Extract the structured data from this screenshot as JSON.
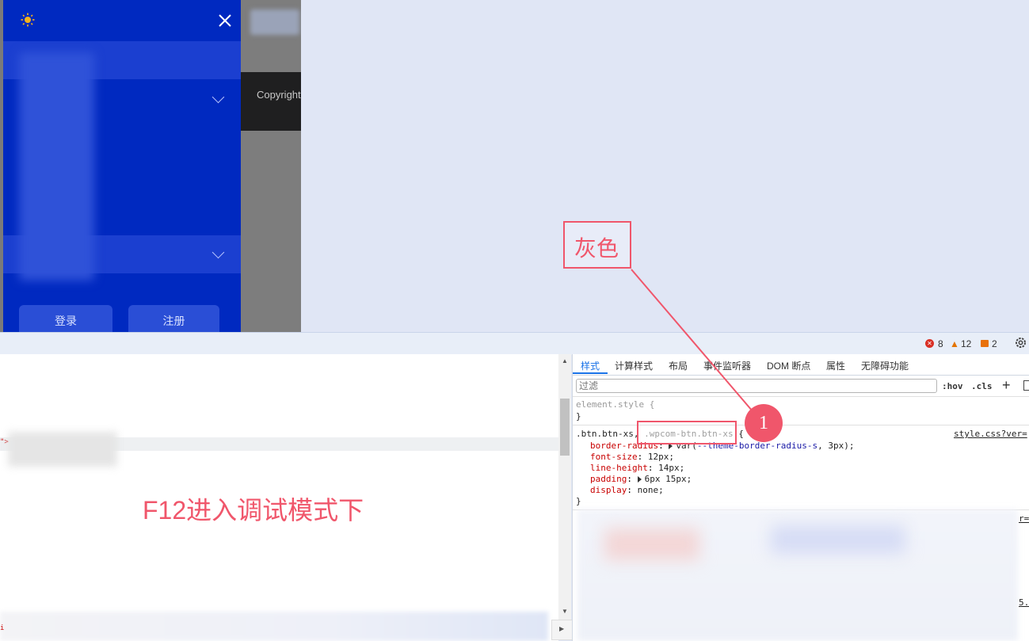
{
  "preview": {
    "drawer": {
      "login_label": "登录",
      "register_label": "注册"
    },
    "footer_text": "Copyright"
  },
  "devtools": {
    "issues": {
      "errors": "8",
      "warnings": "12",
      "info": "2"
    },
    "tabs": [
      "样式",
      "计算样式",
      "布局",
      "事件监听器",
      "DOM 断点",
      "属性",
      "无障碍功能"
    ],
    "filter_placeholder": "过滤",
    "hov_label": ":hov",
    "cls_label": ".cls",
    "rules": {
      "element_style": "element.style {",
      "close_brace": "}",
      "selector_main": ".btn.btn-xs, ",
      "selector_gray": ".wpcom-btn.btn-xs",
      "selector_open": " {",
      "source": "style.css?ver=",
      "source_partial": "r=",
      "source_partial2": "5.",
      "decls": [
        {
          "prop": "border-radius",
          "val_prefix": "var(",
          "var": "--theme-border-radius-s",
          "val_suffix": ", 3px);",
          "expand": true
        },
        {
          "prop": "font-size",
          "val": "12px;",
          "expand": false
        },
        {
          "prop": "line-height",
          "val": "14px;",
          "expand": false
        },
        {
          "prop": "padding",
          "val": "6px 15px;",
          "expand": true
        },
        {
          "prop": "display",
          "val": "none;",
          "expand": false
        }
      ]
    },
    "dom_marker": "\">",
    "dom_marker2": "i"
  },
  "annotations": {
    "gray_label": "灰色",
    "marker_number": "1",
    "f12_caption": "F12进入调试模式下"
  },
  "colors": {
    "drawer_bg": "#0029c0",
    "annotation": "#f0566b",
    "tab_active": "#1a73e8"
  }
}
